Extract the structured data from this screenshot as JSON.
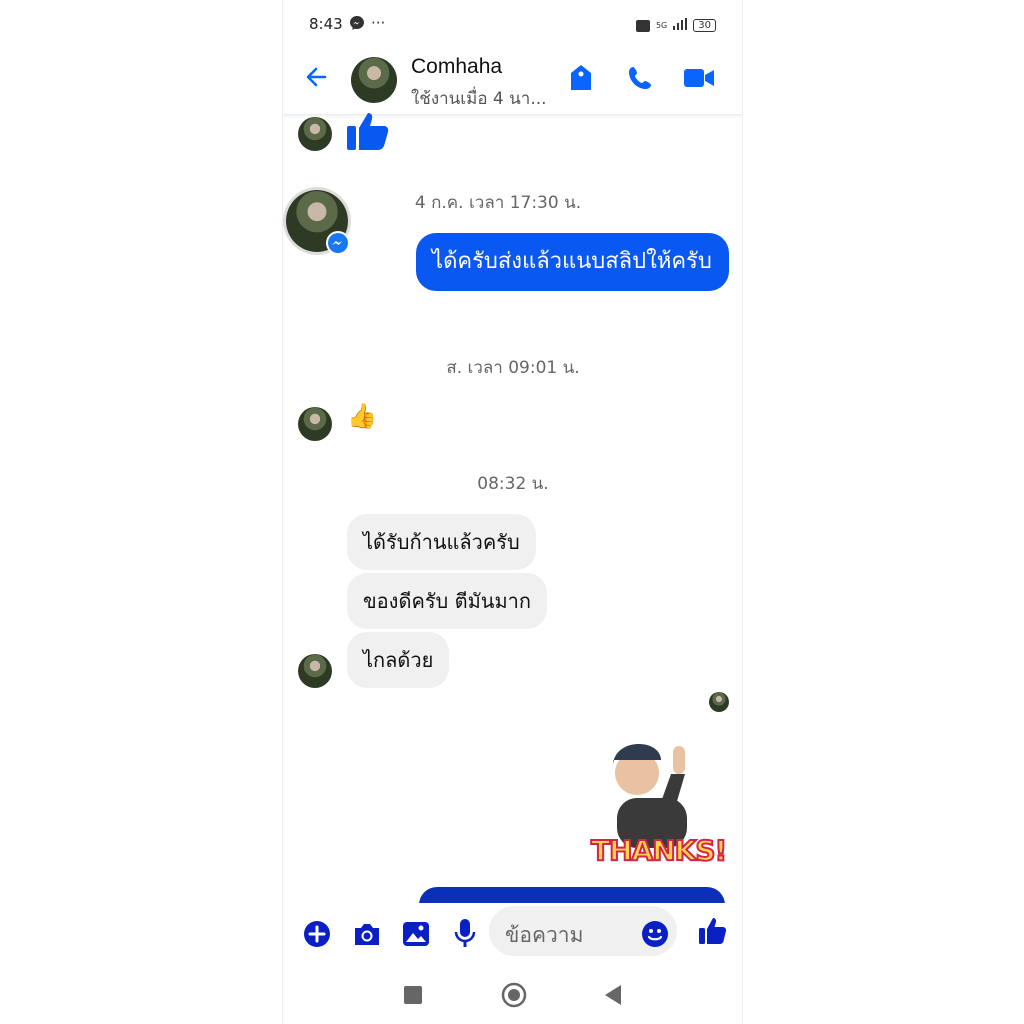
{
  "status_bar": {
    "time": "8:43",
    "dots": "···",
    "network": "5G",
    "battery": "30"
  },
  "header": {
    "contact_name": "Comhaha",
    "active_status": "ใช้งานเมื่อ 4 นา..."
  },
  "messages": {
    "timestamp_1": "4 ก.ค. เวลา 17:30 น.",
    "outgoing_1": "ได้ครับส่งแล้วแนบสลิปให้ครับ",
    "timestamp_2": "ส. เวลา 09:01 น.",
    "emoji_thumbs": "👍",
    "timestamp_3": "08:32 น.",
    "incoming_1": "ได้รับก้านแล้วครับ",
    "incoming_2": "ของดีครับ ตีมันมาก",
    "incoming_3": "ไกลด้วย",
    "sticker_text": "THANKS!"
  },
  "composer": {
    "placeholder": "ข้อความ"
  },
  "colors": {
    "accent": "#0866ff",
    "outgoing_bubble": "#0a58f2",
    "incoming_bubble": "#f0f0f0",
    "composer_icons": "#0a1fc4"
  }
}
